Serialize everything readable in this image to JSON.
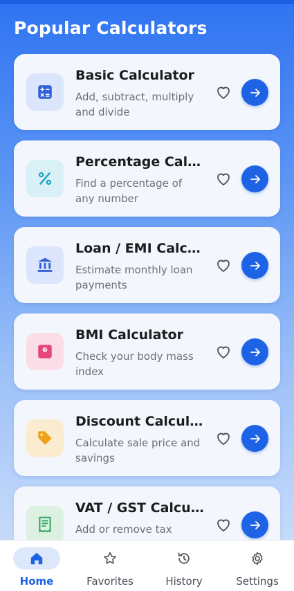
{
  "header": {
    "title": "Popular Calculators"
  },
  "calculators": [
    {
      "title": "Basic Calculator",
      "description": "Add, subtract, multiply and divide",
      "icon": "calculator-icon",
      "color": "#2f5fd8",
      "bg": "#dbe5fb"
    },
    {
      "title": "Percentage Calculator",
      "description": "Find a percentage of any number",
      "icon": "percent-icon",
      "color": "#1aa3c2",
      "bg": "#d9f0f6"
    },
    {
      "title": "Loan / EMI Calculator",
      "description": "Estimate monthly loan payments",
      "icon": "bank-icon",
      "color": "#2f5fd8",
      "bg": "#dbe5fb"
    },
    {
      "title": "BMI Calculator",
      "description": "Check your body mass index",
      "icon": "scale-icon",
      "color": "#e8457a",
      "bg": "#fbdde7"
    },
    {
      "title": "Discount Calculator",
      "description": "Calculate sale price and savings",
      "icon": "tag-icon",
      "color": "#f0a21b",
      "bg": "#fbeccf"
    },
    {
      "title": "VAT / GST Calculator",
      "description": "Add or remove tax",
      "icon": "receipt-icon",
      "color": "#2fa35a",
      "bg": "#dcf1e2"
    }
  ],
  "nav": {
    "active": "Home",
    "items": [
      {
        "label": "Home",
        "icon": "home-icon"
      },
      {
        "label": "Favorites",
        "icon": "star-icon"
      },
      {
        "label": "History",
        "icon": "history-icon"
      },
      {
        "label": "Settings",
        "icon": "gear-icon"
      }
    ]
  },
  "colors": {
    "accent": "#1e63e6",
    "gradient_top": "#2f73f1",
    "gradient_bottom": "#d2e3fb"
  }
}
